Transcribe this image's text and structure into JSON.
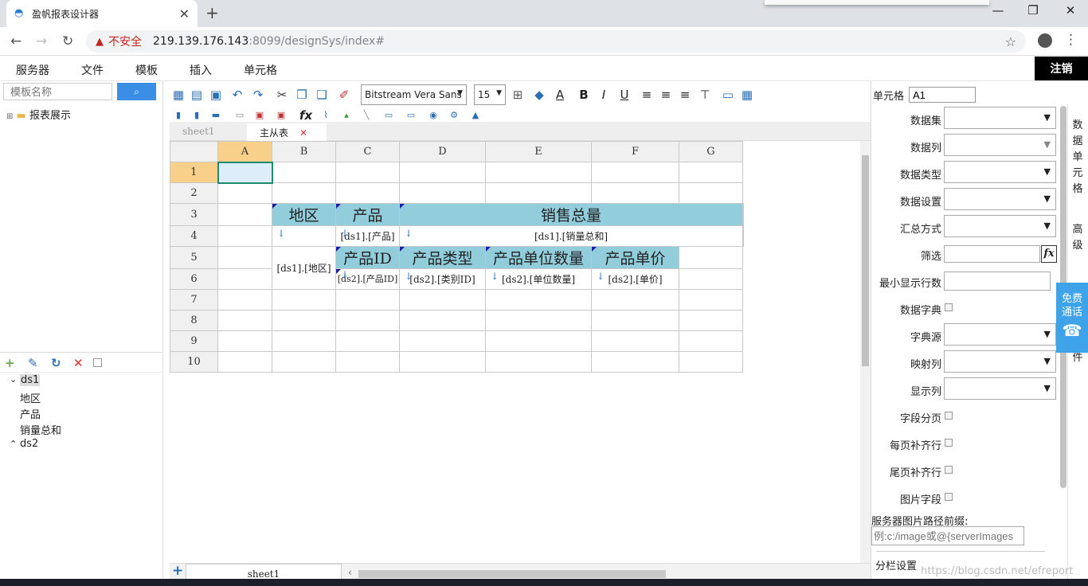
{
  "browser": {
    "tab_title": "盈帆报表设计器",
    "tab_close": "✕",
    "new_tab": "+",
    "security_label": "不安全",
    "url_host": "219.139.176.143",
    "url_path": ":8099/designSys/index#",
    "window_buttons": [
      "—",
      "❐",
      "✕"
    ]
  },
  "menubar": {
    "items": [
      "服务器",
      "文件",
      "模板",
      "插入",
      "单元格"
    ],
    "logout": "注销"
  },
  "left_panel": {
    "search_placeholder": "模板名称",
    "search_button_icon": "search-icon",
    "tree_root": "报表展示",
    "datasets": [
      {
        "name": "ds1",
        "expanded": true,
        "fields": [
          "地区",
          "产品",
          "销量总和"
        ]
      },
      {
        "name": "ds2",
        "expanded": false,
        "fields": []
      }
    ]
  },
  "toolbar": {
    "font_family": "Bitstream Vera Sans",
    "font_size": "15"
  },
  "sheet_tabs": [
    "sheet1",
    "主从表"
  ],
  "bottom_tab": "sheet1",
  "grid": {
    "columns": [
      "A",
      "B",
      "C",
      "D",
      "E",
      "F",
      "G"
    ],
    "rows": [
      "1",
      "2",
      "3",
      "4",
      "5",
      "6",
      "7",
      "8",
      "9",
      "10"
    ],
    "cells": {
      "B3": "地区",
      "C3": "产品",
      "D3": "销售总量",
      "C4": "[ds1].[产品]",
      "D4": "[ds1].[销量总和]",
      "B5": "[ds1].[地区]",
      "C5": "产品ID",
      "D5": "产品类型",
      "E5": "产品单位数量",
      "F5": "产品单价",
      "C6": "[ds2].[产品ID]",
      "D6": "[ds2].[类别ID]",
      "E6": "[ds2].[单位数量]",
      "F6": "[ds2].[单价]"
    },
    "arrow_glyph": "↓"
  },
  "right_panel": {
    "cell_label": "单元格",
    "cell_value": "A1",
    "fields": [
      {
        "label": "数据集",
        "kind": "select"
      },
      {
        "label": "数据列",
        "kind": "select"
      },
      {
        "label": "数据类型",
        "kind": "select"
      },
      {
        "label": "数据设置",
        "kind": "select"
      },
      {
        "label": "汇总方式",
        "kind": "select"
      },
      {
        "label": "筛选",
        "kind": "fx"
      },
      {
        "label": "最小显示行数",
        "kind": "input"
      },
      {
        "label": "数据字典",
        "kind": "checkbox"
      },
      {
        "label": "字典源",
        "kind": "select"
      },
      {
        "label": "映射列",
        "kind": "select"
      },
      {
        "label": "显示列",
        "kind": "select"
      },
      {
        "label": "字段分页",
        "kind": "checkbox"
      },
      {
        "label": "每页补齐行",
        "kind": "checkbox"
      },
      {
        "label": "尾页补齐行",
        "kind": "checkbox"
      },
      {
        "label": "图片字段",
        "kind": "checkbox"
      }
    ],
    "fx_label": "fx",
    "image_path_label": "服务器图片路径前缀:",
    "image_path_placeholder": "例:c:/image或@{serverImages",
    "section_label": "分栏设置",
    "side_tabs": [
      "数据单元格",
      "高级",
      "件"
    ],
    "call_text": "免费通话",
    "call_icon": "phone-icon"
  },
  "watermark": "https://blog.csdn.net/efreport"
}
